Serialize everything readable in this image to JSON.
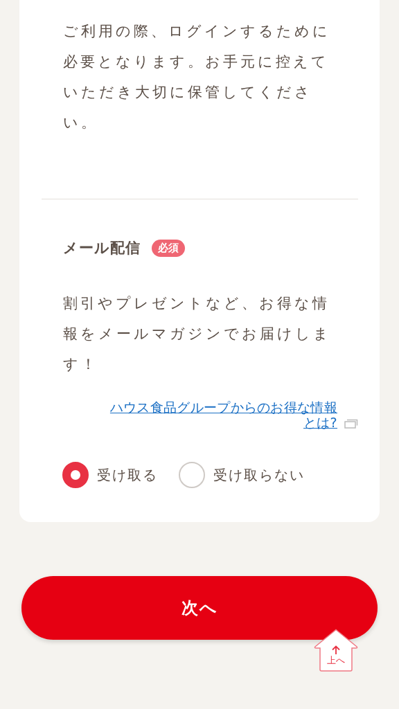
{
  "intro": {
    "text": "ご利用の際、ログインするために必要となります。お手元に控えていただき大切に保管してください。"
  },
  "mail_section": {
    "title": "メール配信",
    "badge": "必須",
    "description": "割引やプレゼントなど、お得な情報をメールマガジンでお届けします！",
    "link": "ハウス食品グループからのお得な情報とは?",
    "options": [
      {
        "label": "受け取る",
        "selected": true
      },
      {
        "label": "受け取らない",
        "selected": false
      }
    ]
  },
  "next_button": "次へ",
  "back_to_top": "上へ"
}
